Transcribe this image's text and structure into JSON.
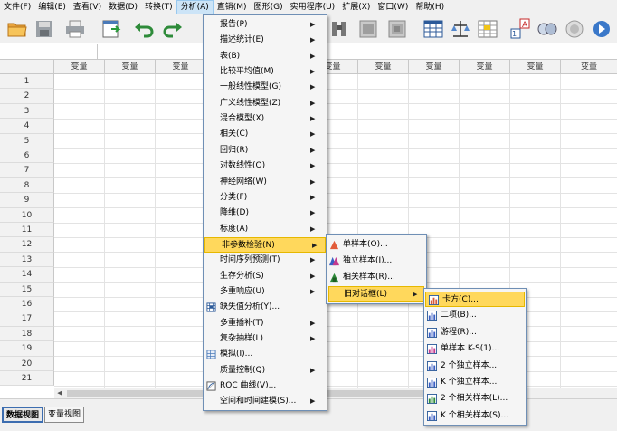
{
  "menubar": {
    "items": [
      "文件(F)",
      "编辑(E)",
      "查看(V)",
      "数据(D)",
      "转换(T)",
      "分析(A)",
      "直销(M)",
      "图形(G)",
      "实用程序(U)",
      "扩展(X)",
      "窗口(W)",
      "帮助(H)"
    ]
  },
  "grid": {
    "column_label": "变量",
    "rows": [
      "1",
      "2",
      "3",
      "4",
      "5",
      "6",
      "7",
      "8",
      "9",
      "10",
      "11",
      "12",
      "13",
      "14",
      "15",
      "16",
      "17",
      "18",
      "19",
      "20",
      "21"
    ]
  },
  "tabs": {
    "data_view": "数据视图",
    "variable_view": "变量视图"
  },
  "analyze_menu": {
    "items": [
      "报告(P)",
      "描述统计(E)",
      "表(B)",
      "比较平均值(M)",
      "一般线性模型(G)",
      "广义线性模型(Z)",
      "混合模型(X)",
      "相关(C)",
      "回归(R)",
      "对数线性(O)",
      "神经网络(W)",
      "分类(F)",
      "降维(D)",
      "标度(A)",
      "非参数检验(N)",
      "时间序列预测(T)",
      "生存分析(S)",
      "多重响应(U)",
      "缺失值分析(Y)...",
      "多重插补(T)",
      "复杂抽样(L)",
      "模拟(I)...",
      "质量控制(Q)",
      "ROC 曲线(V)...",
      "空间和时间建模(S)..."
    ]
  },
  "nonparam_menu": {
    "items": [
      "单样本(O)...",
      "独立样本(I)...",
      "相关样本(R)...",
      "旧对话框(L)"
    ]
  },
  "legacy_menu": {
    "items": [
      "卡方(C)...",
      "二项(B)...",
      "游程(R)...",
      "单样本 K-S(1)...",
      "2 个独立样本...",
      "K 个独立样本...",
      "2 个相关样本(L)...",
      "K 个相关样本(S)..."
    ]
  },
  "colors": {
    "highlight": "#ffd85c",
    "menu_border": "#6f8fb5",
    "active_menu": "#cce4f7",
    "tab_border": "#3c6db0"
  },
  "toolbar_icons": [
    "open-folder-icon",
    "save-icon",
    "print-icon",
    "recall-dialog-icon",
    "undo-icon",
    "redo-icon",
    "goto-case-icon",
    "variables-icon",
    "find-icon",
    "insert-cases-icon",
    "insert-variable-icon",
    "split-file-icon",
    "weight-cases-icon",
    "select-cases-icon",
    "value-labels-icon",
    "use-sets-icon",
    "spelling-icon"
  ]
}
